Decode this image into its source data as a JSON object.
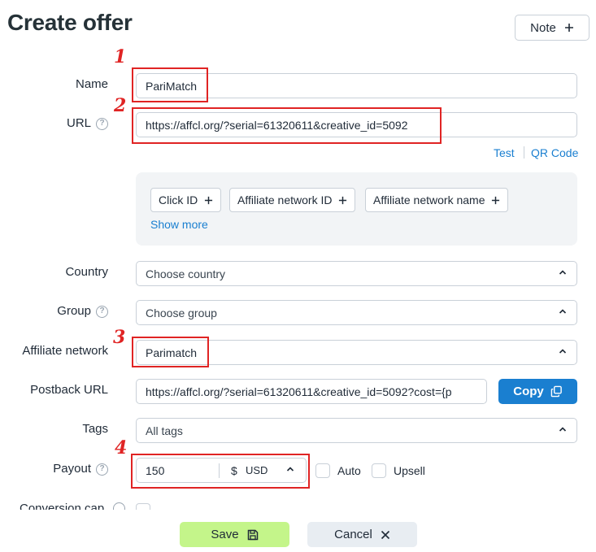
{
  "page": {
    "title": "Create offer"
  },
  "note_button": {
    "label": "Note",
    "icon": "plus-icon"
  },
  "form": {
    "name": {
      "label": "Name",
      "value": "PariMatch"
    },
    "url": {
      "label": "URL",
      "value": "https://affcl.org/?serial=61320611&creative_id=5092",
      "links": {
        "test": "Test",
        "qr": "QR Code"
      }
    },
    "params": {
      "chips": [
        "Click ID",
        "Affiliate network ID",
        "Affiliate network name"
      ],
      "show_more": "Show more"
    },
    "country": {
      "label": "Country",
      "placeholder": "Choose country"
    },
    "group": {
      "label": "Group",
      "placeholder": "Choose group"
    },
    "affiliate_network": {
      "label": "Affiliate network",
      "value": "Parimatch"
    },
    "postback_url": {
      "label": "Postback URL",
      "value": "https://affcl.org/?serial=61320611&creative_id=5092?cost={p",
      "copy_label": "Copy"
    },
    "tags": {
      "label": "Tags",
      "placeholder": "All tags"
    },
    "payout": {
      "label": "Payout",
      "value": "150",
      "currency_symbol": "$",
      "currency": "USD",
      "auto_label": "Auto",
      "upsell_label": "Upsell"
    },
    "conversion_cap": {
      "label": "Conversion cap"
    }
  },
  "actions": {
    "save": "Save",
    "cancel": "Cancel"
  },
  "annotations": {
    "n1": "1",
    "n2": "2",
    "n3": "3",
    "n4": "4",
    "color": "#e02424"
  },
  "colors": {
    "accent": "#1a7fd0",
    "save_bg": "#c4f58a"
  }
}
